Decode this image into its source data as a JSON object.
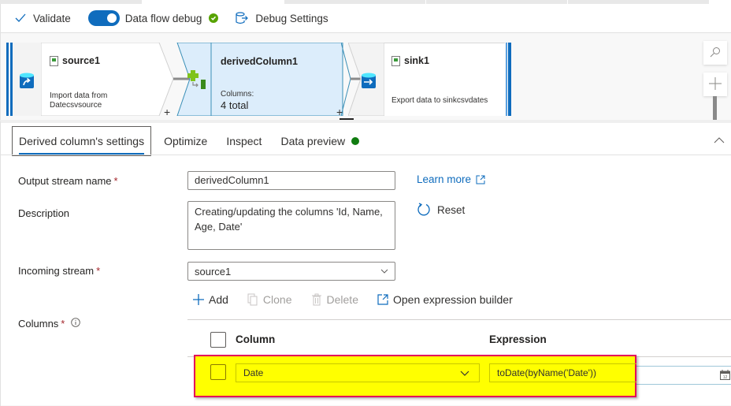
{
  "toolbar": {
    "validate_label": "Validate",
    "debug_label": "Data flow debug",
    "debug_on": true,
    "debug_settings_label": "Debug Settings"
  },
  "canvas": {
    "source": {
      "title": "source1",
      "desc_line1": "Import data from",
      "desc_line2": "Datecsvsource",
      "icon": "database-import-icon"
    },
    "derived": {
      "title": "derivedColumn1",
      "columns_label": "Columns:",
      "columns_value": "4 total",
      "icon": "derived-column-icon"
    },
    "sink": {
      "title": "sink1",
      "desc": "Export data to sinkcsvdates",
      "icon": "database-export-icon"
    },
    "add_symbol": "+",
    "search_icon": "search-icon",
    "zoom_in_icon": "plus-icon"
  },
  "tabs": [
    {
      "label": "Derived column's settings",
      "active": true
    },
    {
      "label": "Optimize",
      "active": false
    },
    {
      "label": "Inspect",
      "active": false
    },
    {
      "label": "Data preview",
      "active": false,
      "status_color": "#107c10"
    }
  ],
  "form": {
    "output_stream_label": "Output stream name",
    "output_stream_value": "derivedColumn1",
    "description_label": "Description",
    "description_value": "Creating/updating the columns 'Id, Name, Age, Date'",
    "incoming_stream_label": "Incoming stream",
    "incoming_stream_value": "source1",
    "columns_label": "Columns",
    "required_mark": "*",
    "learn_more_label": "Learn more",
    "reset_label": "Reset"
  },
  "column_actions": {
    "add_label": "Add",
    "clone_label": "Clone",
    "delete_label": "Delete",
    "open_builder_label": "Open expression builder"
  },
  "columns_table": {
    "headers": {
      "column": "Column",
      "expression": "Expression"
    },
    "rows": [
      {
        "column": "Date",
        "expression": "toDate(byName('Date'))",
        "highlighted": true
      }
    ]
  },
  "colors": {
    "accent": "#0f6cbd",
    "highlight_fill": "#ffff00",
    "highlight_border": "#e3005b",
    "success": "#57a300"
  }
}
